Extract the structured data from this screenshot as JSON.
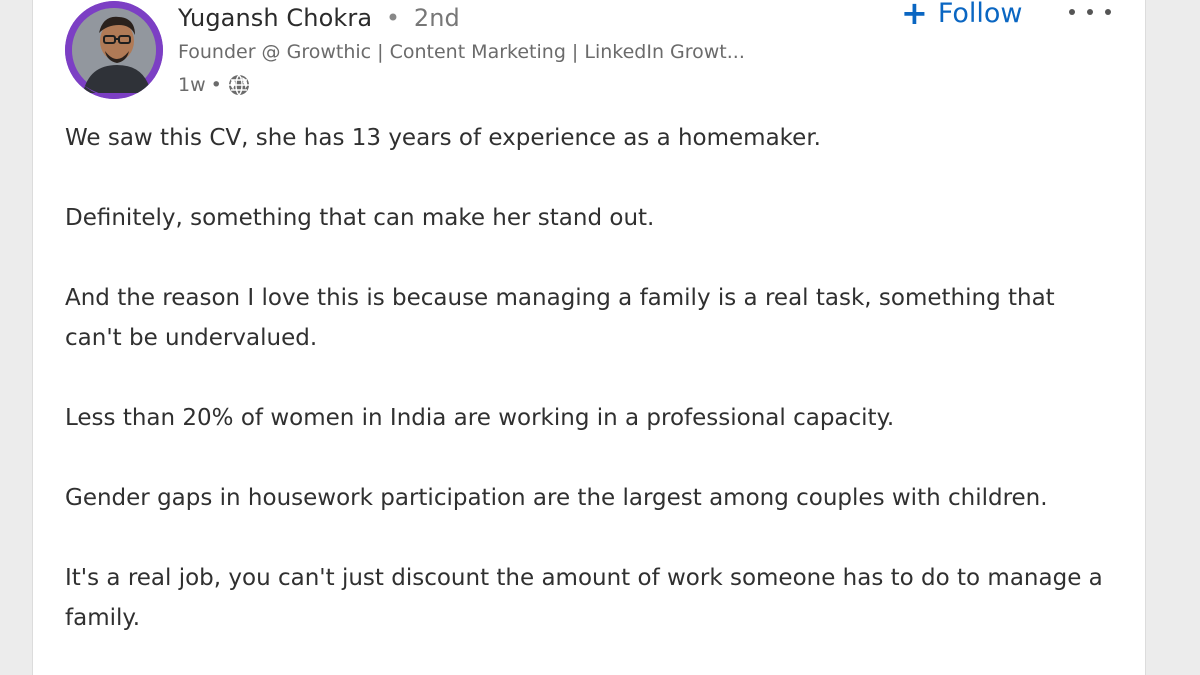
{
  "author": {
    "name": "Yugansh Chokra",
    "separator": "•",
    "degree": "2nd",
    "headline": "Founder @ Growthic | Content Marketing | LinkedIn Growt...",
    "time": "1w",
    "time_separator": "•",
    "visibility_icon": "globe-icon",
    "avatar_badge_color": "#7c3fc4"
  },
  "actions": {
    "follow_icon": "plus-icon",
    "follow_label": "Follow",
    "more_icon": "more-options-icon",
    "accent_color": "#0a66c2"
  },
  "post": {
    "paragraphs": [
      "We saw this CV, she has 13 years of experience as a homemaker.",
      "Definitely, something that can make her stand out.",
      "And the reason I love this is because managing a family is a real task, something that can't be undervalued.",
      "Less than 20% of women in India are working in a professional capacity.",
      "Gender gaps in housework participation are the largest among couples with children.",
      "It's a real job, you can't just discount the amount of work someone has to do to manage a family."
    ]
  }
}
